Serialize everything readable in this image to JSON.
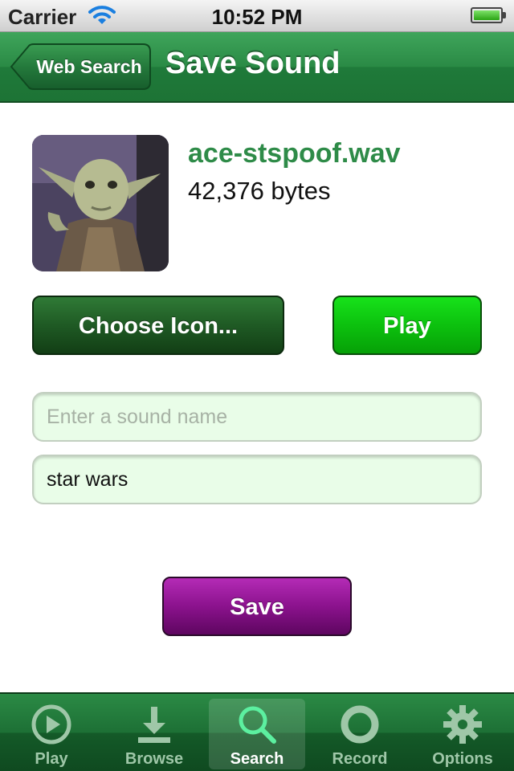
{
  "status_bar": {
    "carrier": "Carrier",
    "time": "10:52 PM",
    "wifi_icon": "wifi-icon",
    "battery_icon": "battery-icon",
    "battery_level": 1.0
  },
  "nav": {
    "back_label": "Web Search",
    "title": "Save Sound"
  },
  "sound": {
    "filename": "ace-stspoof.wav",
    "size": "42,376 bytes",
    "icon": "yoda-image"
  },
  "buttons": {
    "choose_icon": "Choose Icon...",
    "play": "Play",
    "save": "Save"
  },
  "fields": {
    "name": {
      "placeholder": "Enter a sound name",
      "value": ""
    },
    "tags": {
      "value": "star wars"
    }
  },
  "tabbar": {
    "selected": "Search",
    "items": [
      {
        "label": "Play",
        "icon": "play-icon"
      },
      {
        "label": "Browse",
        "icon": "download-icon"
      },
      {
        "label": "Search",
        "icon": "search-icon"
      },
      {
        "label": "Record",
        "icon": "record-icon"
      },
      {
        "label": "Options",
        "icon": "gear-icon"
      }
    ]
  },
  "colors": {
    "nav_green": "#2a8a45",
    "choose_green": "#1f5a24",
    "play_green": "#0cc10e",
    "save_purple": "#8b128d",
    "filename_green": "#2e8b48",
    "field_bg": "#e9fde8"
  }
}
